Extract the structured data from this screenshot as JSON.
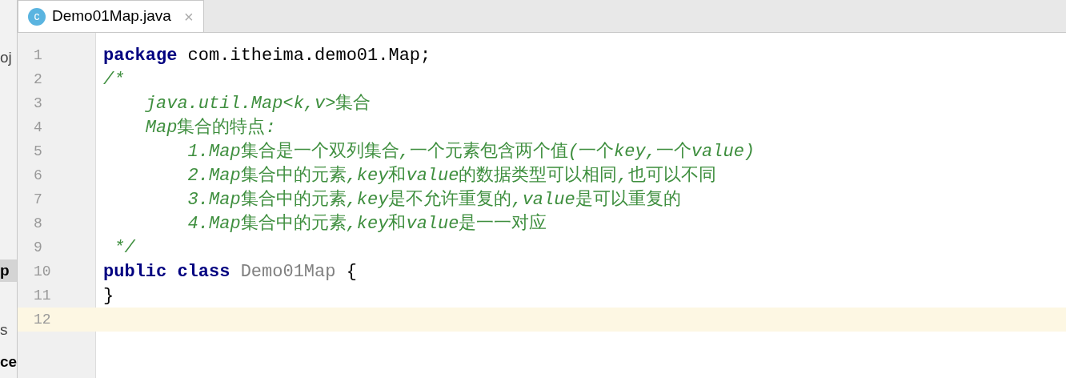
{
  "side_panel": {
    "items": [
      {
        "text": "oj",
        "kind": "plain",
        "selected": false
      },
      {
        "text": "p",
        "kind": "bold",
        "selected": true
      },
      {
        "text": "s",
        "kind": "plain",
        "selected": false
      },
      {
        "text": "ce",
        "kind": "bold",
        "selected": false
      }
    ]
  },
  "tabs": [
    {
      "icon_letter": "c",
      "label": "Demo01Map.java",
      "close": "×",
      "selected": true
    }
  ],
  "editor": {
    "lines": [
      {
        "number": "1",
        "current": false,
        "segments": [
          {
            "kind": "keyword",
            "text": "package"
          },
          {
            "kind": "plain",
            "text": " com.itheima.demo01.Map;"
          }
        ]
      },
      {
        "number": "2",
        "current": false,
        "segments": [
          {
            "kind": "comment_italic",
            "text": "/*"
          }
        ]
      },
      {
        "number": "3",
        "current": false,
        "segments": [
          {
            "kind": "comment_italic",
            "text": "    java.util.Map<k,v>"
          },
          {
            "kind": "comment",
            "text": "集合"
          }
        ]
      },
      {
        "number": "4",
        "current": false,
        "segments": [
          {
            "kind": "comment_italic",
            "text": "    Map"
          },
          {
            "kind": "comment",
            "text": "集合的特点"
          },
          {
            "kind": "comment_italic",
            "text": ":"
          }
        ]
      },
      {
        "number": "5",
        "current": false,
        "segments": [
          {
            "kind": "comment_italic",
            "text": "        1.Map"
          },
          {
            "kind": "comment",
            "text": "集合是一个双列集合"
          },
          {
            "kind": "comment_italic",
            "text": ","
          },
          {
            "kind": "comment",
            "text": "一个元素包含两个值"
          },
          {
            "kind": "comment_italic",
            "text": "("
          },
          {
            "kind": "comment",
            "text": "一个"
          },
          {
            "kind": "comment_italic",
            "text": "key,"
          },
          {
            "kind": "comment",
            "text": "一个"
          },
          {
            "kind": "comment_italic",
            "text": "value)"
          }
        ]
      },
      {
        "number": "6",
        "current": false,
        "segments": [
          {
            "kind": "comment_italic",
            "text": "        2.Map"
          },
          {
            "kind": "comment",
            "text": "集合中的元素"
          },
          {
            "kind": "comment_italic",
            "text": ",key"
          },
          {
            "kind": "comment",
            "text": "和"
          },
          {
            "kind": "comment_italic",
            "text": "value"
          },
          {
            "kind": "comment",
            "text": "的数据类型可以相同"
          },
          {
            "kind": "comment_italic",
            "text": ","
          },
          {
            "kind": "comment",
            "text": "也可以不同"
          }
        ]
      },
      {
        "number": "7",
        "current": false,
        "segments": [
          {
            "kind": "comment_italic",
            "text": "        3.Map"
          },
          {
            "kind": "comment",
            "text": "集合中的元素"
          },
          {
            "kind": "comment_italic",
            "text": ",key"
          },
          {
            "kind": "comment",
            "text": "是不允许重复的"
          },
          {
            "kind": "comment_italic",
            "text": ",value"
          },
          {
            "kind": "comment",
            "text": "是可以重复的"
          }
        ]
      },
      {
        "number": "8",
        "current": false,
        "segments": [
          {
            "kind": "comment_italic",
            "text": "        4.Map"
          },
          {
            "kind": "comment",
            "text": "集合中的元素"
          },
          {
            "kind": "comment_italic",
            "text": ",key"
          },
          {
            "kind": "comment",
            "text": "和"
          },
          {
            "kind": "comment_italic",
            "text": "value"
          },
          {
            "kind": "comment",
            "text": "是一一对应"
          }
        ]
      },
      {
        "number": "9",
        "current": false,
        "segments": [
          {
            "kind": "comment_italic",
            "text": " */"
          }
        ]
      },
      {
        "number": "10",
        "current": false,
        "segments": [
          {
            "kind": "keyword",
            "text": "public class"
          },
          {
            "kind": "classname",
            "text": " Demo01Map"
          },
          {
            "kind": "plain",
            "text": " {"
          }
        ]
      },
      {
        "number": "11",
        "current": false,
        "segments": [
          {
            "kind": "plain",
            "text": "}"
          }
        ]
      },
      {
        "number": "12",
        "current": true
      }
    ]
  }
}
